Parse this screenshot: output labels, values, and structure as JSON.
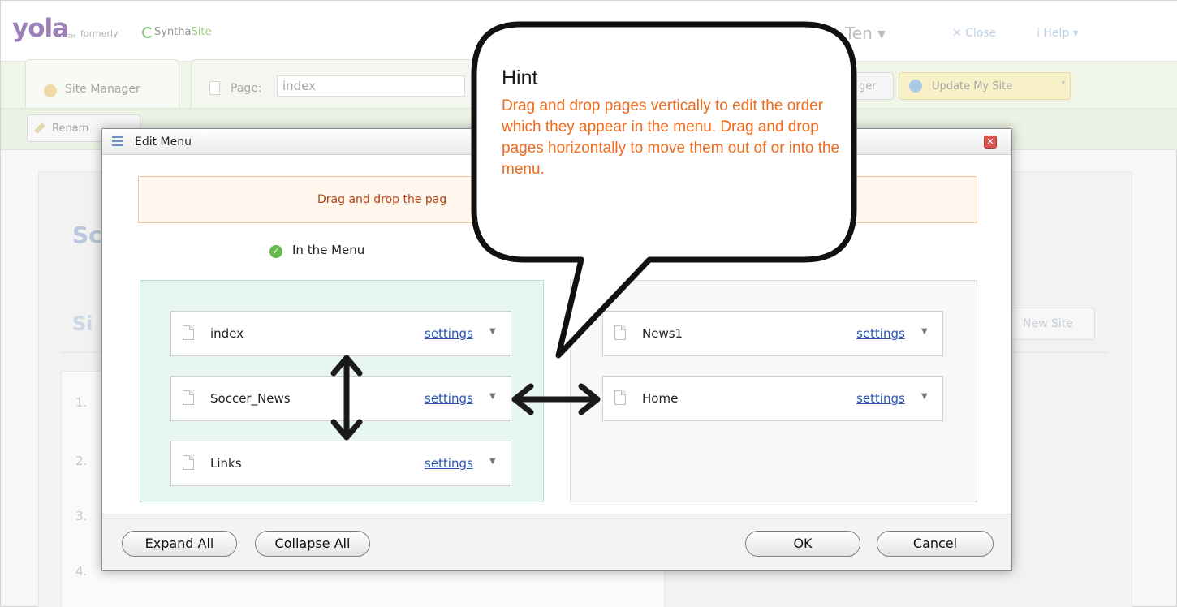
{
  "brand": {
    "logo": "yola",
    "trademark": "TM",
    "formerly": "formerly",
    "syntha": "Syntha",
    "site": "Site"
  },
  "topnav": {
    "site_name": "Ten ▾",
    "close": "✕ Close",
    "help": "i  Help ▾"
  },
  "tabs": {
    "site_manager": "Site Manager",
    "page_label": "Page:",
    "page_value": "index",
    "manager_partial": "ger",
    "update": "Update My Site"
  },
  "subtoolbar": {
    "rename": "Renam"
  },
  "background": {
    "so": "Sc",
    "si": "Si",
    "new_site": "New Site",
    "numbers": [
      "1.",
      "2.",
      "3.",
      "4."
    ]
  },
  "modal": {
    "title": "Edit Menu",
    "instruction": "Drag and drop the pag",
    "in_menu": "In the Menu",
    "in_menu_pages": [
      {
        "name": "index",
        "settings": "settings"
      },
      {
        "name": "Soccer_News",
        "settings": "settings"
      },
      {
        "name": "Links",
        "settings": "settings"
      }
    ],
    "out_menu_pages": [
      {
        "name": "News1",
        "settings": "settings"
      },
      {
        "name": "Home",
        "settings": "settings"
      }
    ],
    "buttons": {
      "expand": "Expand All",
      "collapse": "Collapse All",
      "ok": "OK",
      "cancel": "Cancel"
    }
  },
  "hint": {
    "title": "Hint",
    "body": "Drag and drop pages vertically to edit the order which they appear in the menu.  Drag and drop pages horizontally to move them out of or into the menu."
  },
  "colors": {
    "hint_text": "#f06a1d",
    "settings_link": "#2857b8",
    "in_menu_zone": "#e7f6ee",
    "logo": "#6b3c92"
  }
}
